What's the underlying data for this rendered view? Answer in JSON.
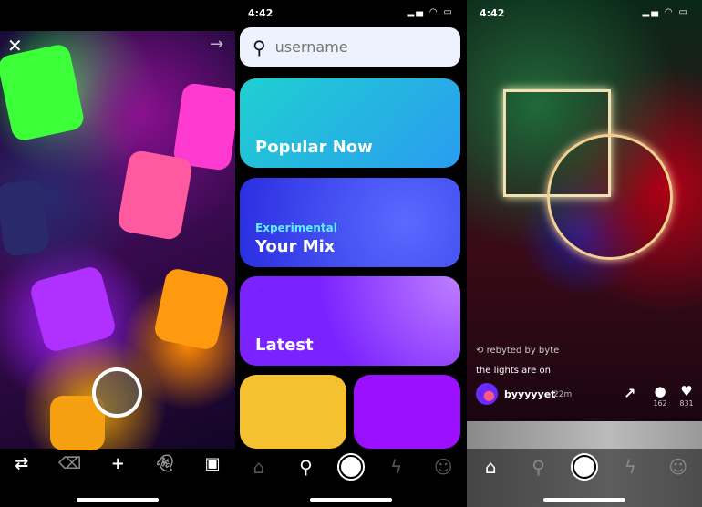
{
  "camera": {
    "close_icon": "close-icon",
    "next_icon": "arrow-right-icon",
    "toolbar": [
      "flip-camera-icon",
      "delete-icon",
      "add-icon",
      "ghost-icon",
      "gallery-icon"
    ]
  },
  "search": {
    "status_time": "4:42",
    "placeholder": "username",
    "cards": [
      {
        "title": "Popular Now",
        "color": "#22c8d8"
      },
      {
        "subtitle": "Experimental",
        "title": "Your Mix",
        "color": "#2a3cf0"
      },
      {
        "title": "Latest",
        "color": "#7a22ff"
      }
    ],
    "bottom_cards": [
      {
        "color": "#f5c12e"
      },
      {
        "color": "#9a10ff"
      }
    ]
  },
  "video": {
    "status_time": "4:42",
    "rebyted_by": "rebyted by byte",
    "caption": "the lights are on",
    "username": "byyyyyet",
    "time_ago": "22m",
    "comments": "162",
    "likes": "831"
  },
  "nav": [
    "home-icon",
    "search-icon",
    "camera-icon",
    "activity-icon",
    "profile-icon"
  ]
}
